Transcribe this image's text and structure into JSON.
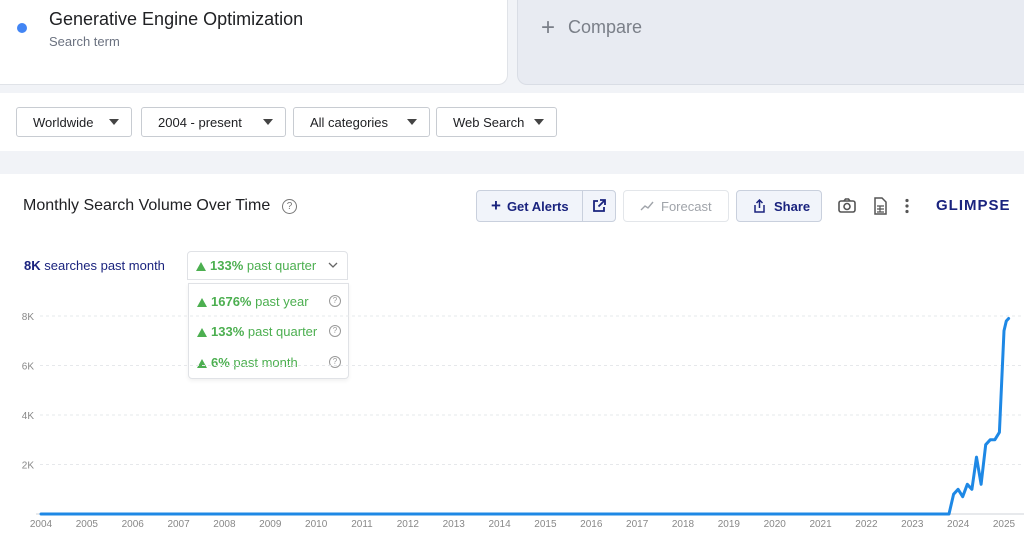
{
  "term": {
    "name": "Generative Engine Optimization",
    "subtitle": "Search term",
    "dot_color": "#4285f4"
  },
  "compare": {
    "plus": "+",
    "label": "Compare"
  },
  "filters": {
    "region": "Worldwide",
    "period": "2004 - present",
    "category": "All categories",
    "search_type": "Web Search"
  },
  "panel": {
    "title": "Monthly Search Volume Over Time",
    "help": "?",
    "get_alerts": "Get Alerts",
    "forecast": "Forecast",
    "share": "Share",
    "brand": "GLIMPSE",
    "accent": "#1a237e"
  },
  "stats": {
    "volume_value": "8K",
    "volume_label": " searches past month",
    "selected_value": "133%",
    "selected_label": " past quarter",
    "dropdown": [
      {
        "value": "1676%",
        "label": " past year"
      },
      {
        "value": "133%",
        "label": " past quarter"
      },
      {
        "value": "6%",
        "label": " past month"
      }
    ],
    "up_color": "#4caf50"
  },
  "chart_data": {
    "type": "line",
    "series_color": "#1e88e5",
    "y_ticks": [
      "2K",
      "4K",
      "6K",
      "8K"
    ],
    "x_ticks": [
      "2004",
      "2005",
      "2006",
      "2007",
      "2008",
      "2009",
      "2010",
      "2011",
      "2012",
      "2013",
      "2014",
      "2015",
      "2016",
      "2017",
      "2018",
      "2019",
      "2020",
      "2021",
      "2022",
      "2023",
      "2024",
      "2025"
    ],
    "ylim": [
      0,
      8000
    ],
    "grid": true,
    "x": [
      2004.0,
      2023.8,
      2023.9,
      2024.0,
      2024.1,
      2024.2,
      2024.3,
      2024.4,
      2024.5,
      2024.6,
      2024.7,
      2024.8,
      2024.9,
      2025.0,
      2025.05,
      2025.1
    ],
    "y": [
      0,
      0,
      800,
      1000,
      700,
      1200,
      1000,
      2300,
      1200,
      2800,
      3000,
      3000,
      3300,
      7400,
      7800,
      7900
    ]
  }
}
